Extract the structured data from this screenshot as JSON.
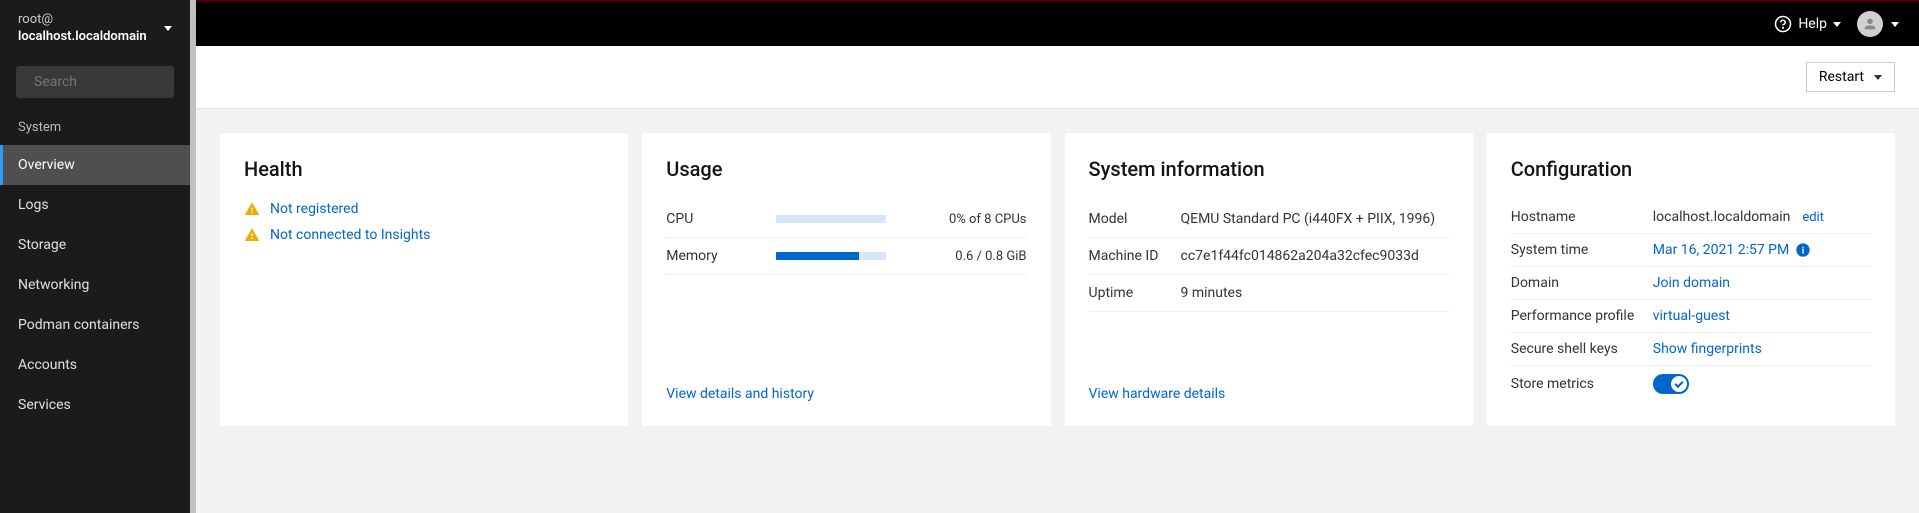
{
  "sidebar": {
    "user": "root@",
    "host": "localhost.localdomain",
    "search_placeholder": "Search",
    "section_label": "System",
    "items": [
      {
        "label": "Overview",
        "active": true
      },
      {
        "label": "Logs"
      },
      {
        "label": "Storage"
      },
      {
        "label": "Networking"
      },
      {
        "label": "Podman containers"
      },
      {
        "label": "Accounts"
      },
      {
        "label": "Services"
      }
    ]
  },
  "topbar": {
    "help_label": "Help"
  },
  "actionbar": {
    "restart_label": "Restart"
  },
  "health": {
    "title": "Health",
    "items": [
      "Not registered",
      "Not connected to Insights"
    ]
  },
  "usage": {
    "title": "Usage",
    "rows": [
      {
        "label": "CPU",
        "value": "0% of 8 CPUs",
        "fill_pct": 0
      },
      {
        "label": "Memory",
        "value": "0.6 / 0.8 GiB",
        "fill_pct": 75
      }
    ],
    "details_link": "View details and history"
  },
  "sysinfo": {
    "title": "System information",
    "rows": [
      {
        "label": "Model",
        "value": "QEMU Standard PC (i440FX + PIIX, 1996)"
      },
      {
        "label": "Machine ID",
        "value": "cc7e1f44fc014862a204a32cfec9033d"
      },
      {
        "label": "Uptime",
        "value": "9 minutes"
      }
    ],
    "details_link": "View hardware details"
  },
  "config": {
    "title": "Configuration",
    "hostname_label": "Hostname",
    "hostname_value": "localhost.localdomain",
    "hostname_edit": "edit",
    "systime_label": "System time",
    "systime_value": "Mar 16, 2021 2:57 PM",
    "domain_label": "Domain",
    "domain_link": "Join domain",
    "perf_label": "Performance profile",
    "perf_link": "virtual-guest",
    "ssh_label": "Secure shell keys",
    "ssh_link": "Show fingerprints",
    "metrics_label": "Store metrics"
  }
}
